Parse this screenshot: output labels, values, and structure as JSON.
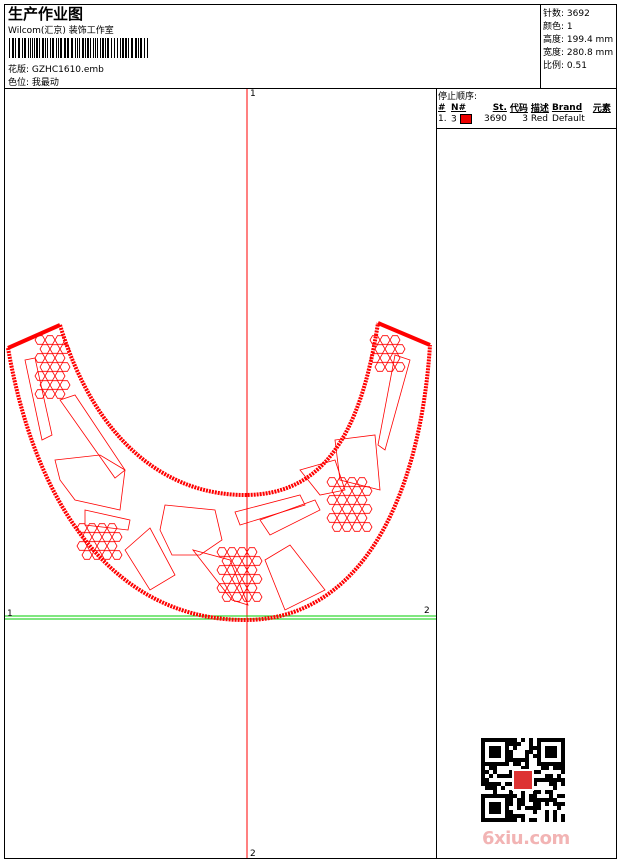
{
  "header": {
    "title": "生产作业图",
    "company": "Wilcom(汇京) 装饰工作室",
    "design_label": "花版:",
    "design_value": "GZHC1610.emb",
    "color_label": "色位:",
    "color_value": "我最动"
  },
  "stats": [
    {
      "label": "针数:",
      "value": "3692"
    },
    {
      "label": "颜色:",
      "value": "1"
    },
    {
      "label": "高度:",
      "value": "199.4 mm"
    },
    {
      "label": "宽度:",
      "value": "280.8 mm"
    },
    {
      "label": "比例:",
      "value": "0.51"
    }
  ],
  "stop_sequence": {
    "title": "停止顺序:",
    "columns": [
      "#",
      "N#",
      "St.",
      "代码",
      "描述",
      "Brand",
      "元素"
    ],
    "rows": [
      {
        "index": "1.",
        "n": "3",
        "color": "#e00000",
        "stitches": "3690",
        "code": "3",
        "desc": "Red",
        "brand": "Default"
      }
    ]
  },
  "axis_markers": {
    "top": "1",
    "bottom": "2",
    "left": "1",
    "right": "2"
  },
  "colors": {
    "thread": "#ff0000",
    "vertical_axis": "#ff0000",
    "horizontal_axis": "#00cc00"
  },
  "watermark": "6xiu.com"
}
